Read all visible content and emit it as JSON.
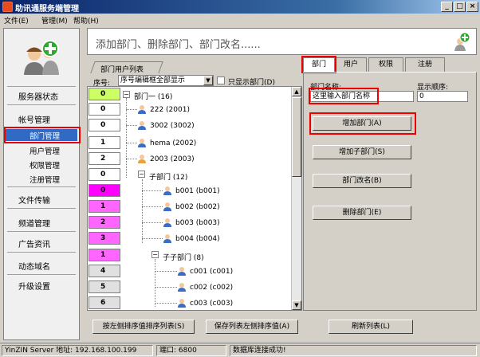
{
  "window": {
    "title": "助讯通服务端管理"
  },
  "menu": {
    "items": [
      "文件(E)",
      "管理(M)",
      "帮助(H)"
    ]
  },
  "sidebar": {
    "items": [
      {
        "label": "服务器状态"
      },
      {
        "label": "帐号管理"
      },
      {
        "label": "部门管理"
      },
      {
        "label": "用户管理"
      },
      {
        "label": "权限管理"
      },
      {
        "label": "注册管理"
      },
      {
        "label": "文件传输"
      },
      {
        "label": "频道管理"
      },
      {
        "label": "广告资讯"
      },
      {
        "label": "动态域名"
      },
      {
        "label": "升级设置"
      }
    ]
  },
  "header": {
    "title": "添加部门、删除部门、部门改名......"
  },
  "list": {
    "tab_label": "部门用户列表",
    "sort_label": "序号:",
    "sort_value": "序号编辑框全部显示",
    "only_dept_label": "只显示部门(D)",
    "seq_values": [
      "0",
      "0",
      "0",
      "1",
      "2",
      "0",
      "0",
      "1",
      "2",
      "3",
      "1",
      "4",
      "5",
      "6"
    ],
    "nodes": [
      {
        "label": "部门一 (16)"
      },
      {
        "label": "222 (2001)"
      },
      {
        "label": "3002 (3002)"
      },
      {
        "label": "hema (2002)"
      },
      {
        "label": "2003 (2003)"
      },
      {
        "label": "子部门 (12)"
      },
      {
        "label": "b001 (b001)"
      },
      {
        "label": "b002 (b002)"
      },
      {
        "label": "b003 (b003)"
      },
      {
        "label": "b004 (b004)"
      },
      {
        "label": "子子部门 (8)"
      },
      {
        "label": "c001 (c001)"
      },
      {
        "label": "c002 (c002)"
      },
      {
        "label": "c003 (c003)"
      }
    ]
  },
  "buttons": {
    "sort_by_left": "按左侧排序值排序列表(S)",
    "save_sort": "保存列表左侧排序值(A)",
    "refresh": "刷新列表(L)",
    "add_dept": "增加部门(A)",
    "add_subdept": "增加子部门(S)",
    "rename_dept": "部门改名(B)",
    "delete_dept": "删除部门(E)"
  },
  "right_tabs": [
    "部门",
    "用户",
    "权限",
    "注册"
  ],
  "form": {
    "dept_name_label": "部门名称:",
    "dept_name_value": "这里输入部门名称",
    "order_label": "显示顺序:",
    "order_value": "0"
  },
  "status": {
    "server": "YinZIN Server 地址: 192.168.100.199",
    "port": "端口: 6800",
    "db": "数据库连接成功!"
  },
  "colors": {
    "seq_green": "#ccff66",
    "seq_magenta": "#ff00ff",
    "seq_pink": "#ff66ff",
    "seq_gray": "#e0e0e0",
    "highlight_red": "#ee0000",
    "selection_blue": "#316ac5"
  }
}
